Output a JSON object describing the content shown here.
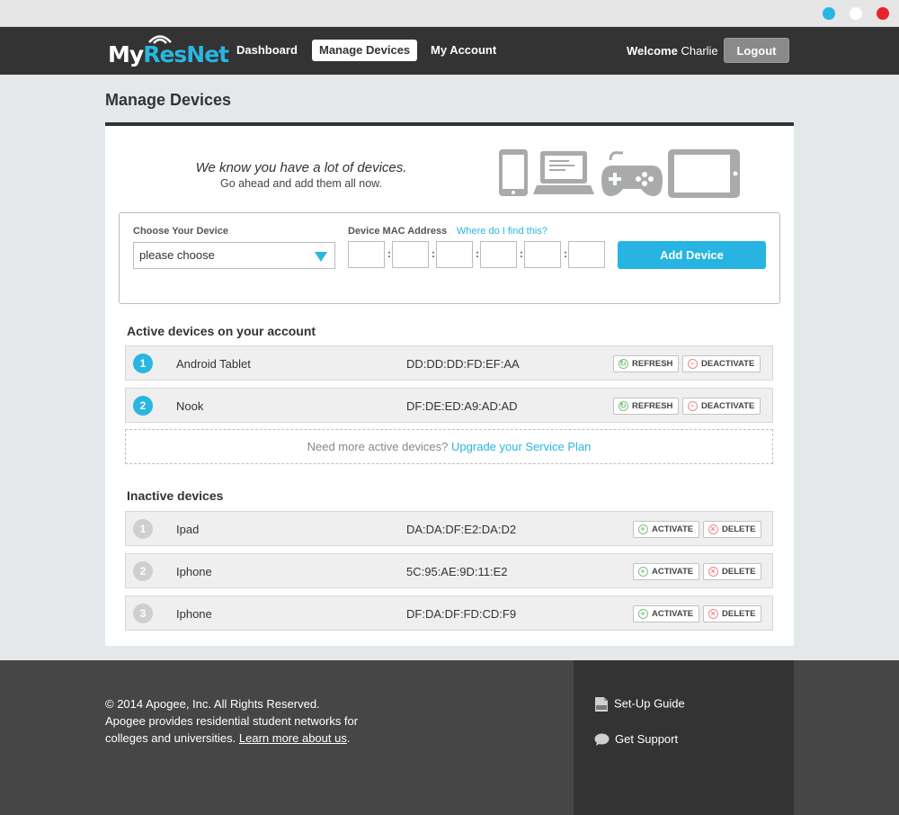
{
  "window": {
    "controls": [
      "minimize",
      "maximize",
      "close"
    ]
  },
  "nav": {
    "logo_my": "My",
    "logo_resnet": "ResNet",
    "items": [
      {
        "label": "Dashboard"
      },
      {
        "label": "Manage Devices",
        "active": true
      },
      {
        "label": "My Account"
      }
    ],
    "welcome_prefix": "Welcome",
    "user": "Charlie",
    "logout": "Logout"
  },
  "page": {
    "title": "Manage Devices"
  },
  "hero": {
    "line1": "We know you have a lot of devices.",
    "line2": "Go ahead and add them all now.",
    "icons": [
      "phone-icon",
      "laptop-icon",
      "gamepad-icon",
      "tablet-icon"
    ]
  },
  "form": {
    "device_label": "Choose Your Device",
    "device_value": "please choose",
    "mac_label": "Device MAC Address",
    "mac_help": "Where do I find this?",
    "mac_octets": [
      "",
      "",
      "",
      "",
      "",
      ""
    ],
    "add_button": "Add Device"
  },
  "active": {
    "title": "Active devices on your account",
    "devices": [
      {
        "num": "1",
        "name": "Android Tablet",
        "mac": "DD:DD:DD:FD:EF:AA",
        "action1": "REFRESH",
        "action2": "DEACTIVATE"
      },
      {
        "num": "2",
        "name": "Nook",
        "mac": "DF:DE:ED:A9:AD:AD",
        "action1": "REFRESH",
        "action2": "DEACTIVATE"
      }
    ],
    "upgrade_text": "Need more active devices?",
    "upgrade_link": "Upgrade your Service Plan"
  },
  "inactive": {
    "title": "Inactive devices",
    "devices": [
      {
        "num": "1",
        "name": "Ipad",
        "mac": "DA:DA:DF:E2:DA:D2",
        "action1": "ACTIVATE",
        "action2": "DELETE"
      },
      {
        "num": "2",
        "name": "Iphone",
        "mac": "5C:95:AE:9D:11:E2",
        "action1": "ACTIVATE",
        "action2": "DELETE"
      },
      {
        "num": "3",
        "name": "Iphone",
        "mac": "DF:DA:DF:FD:CD:F9",
        "action1": "ACTIVATE",
        "action2": "DELETE"
      }
    ]
  },
  "footer": {
    "copyright": "© 2014 Apogee, Inc. All Rights Reserved.",
    "line2": "Apogee provides residential student networks for",
    "line3": "colleges and universities.",
    "learn_more": "Learn more about us",
    "line3_end": ".",
    "setup_guide": "Set-Up Guide",
    "support": "Get Support"
  },
  "colors": {
    "accent": "#29b6e0",
    "nav_bg": "#333333",
    "footer_bg": "#464646",
    "window_close": "#e8242b"
  }
}
